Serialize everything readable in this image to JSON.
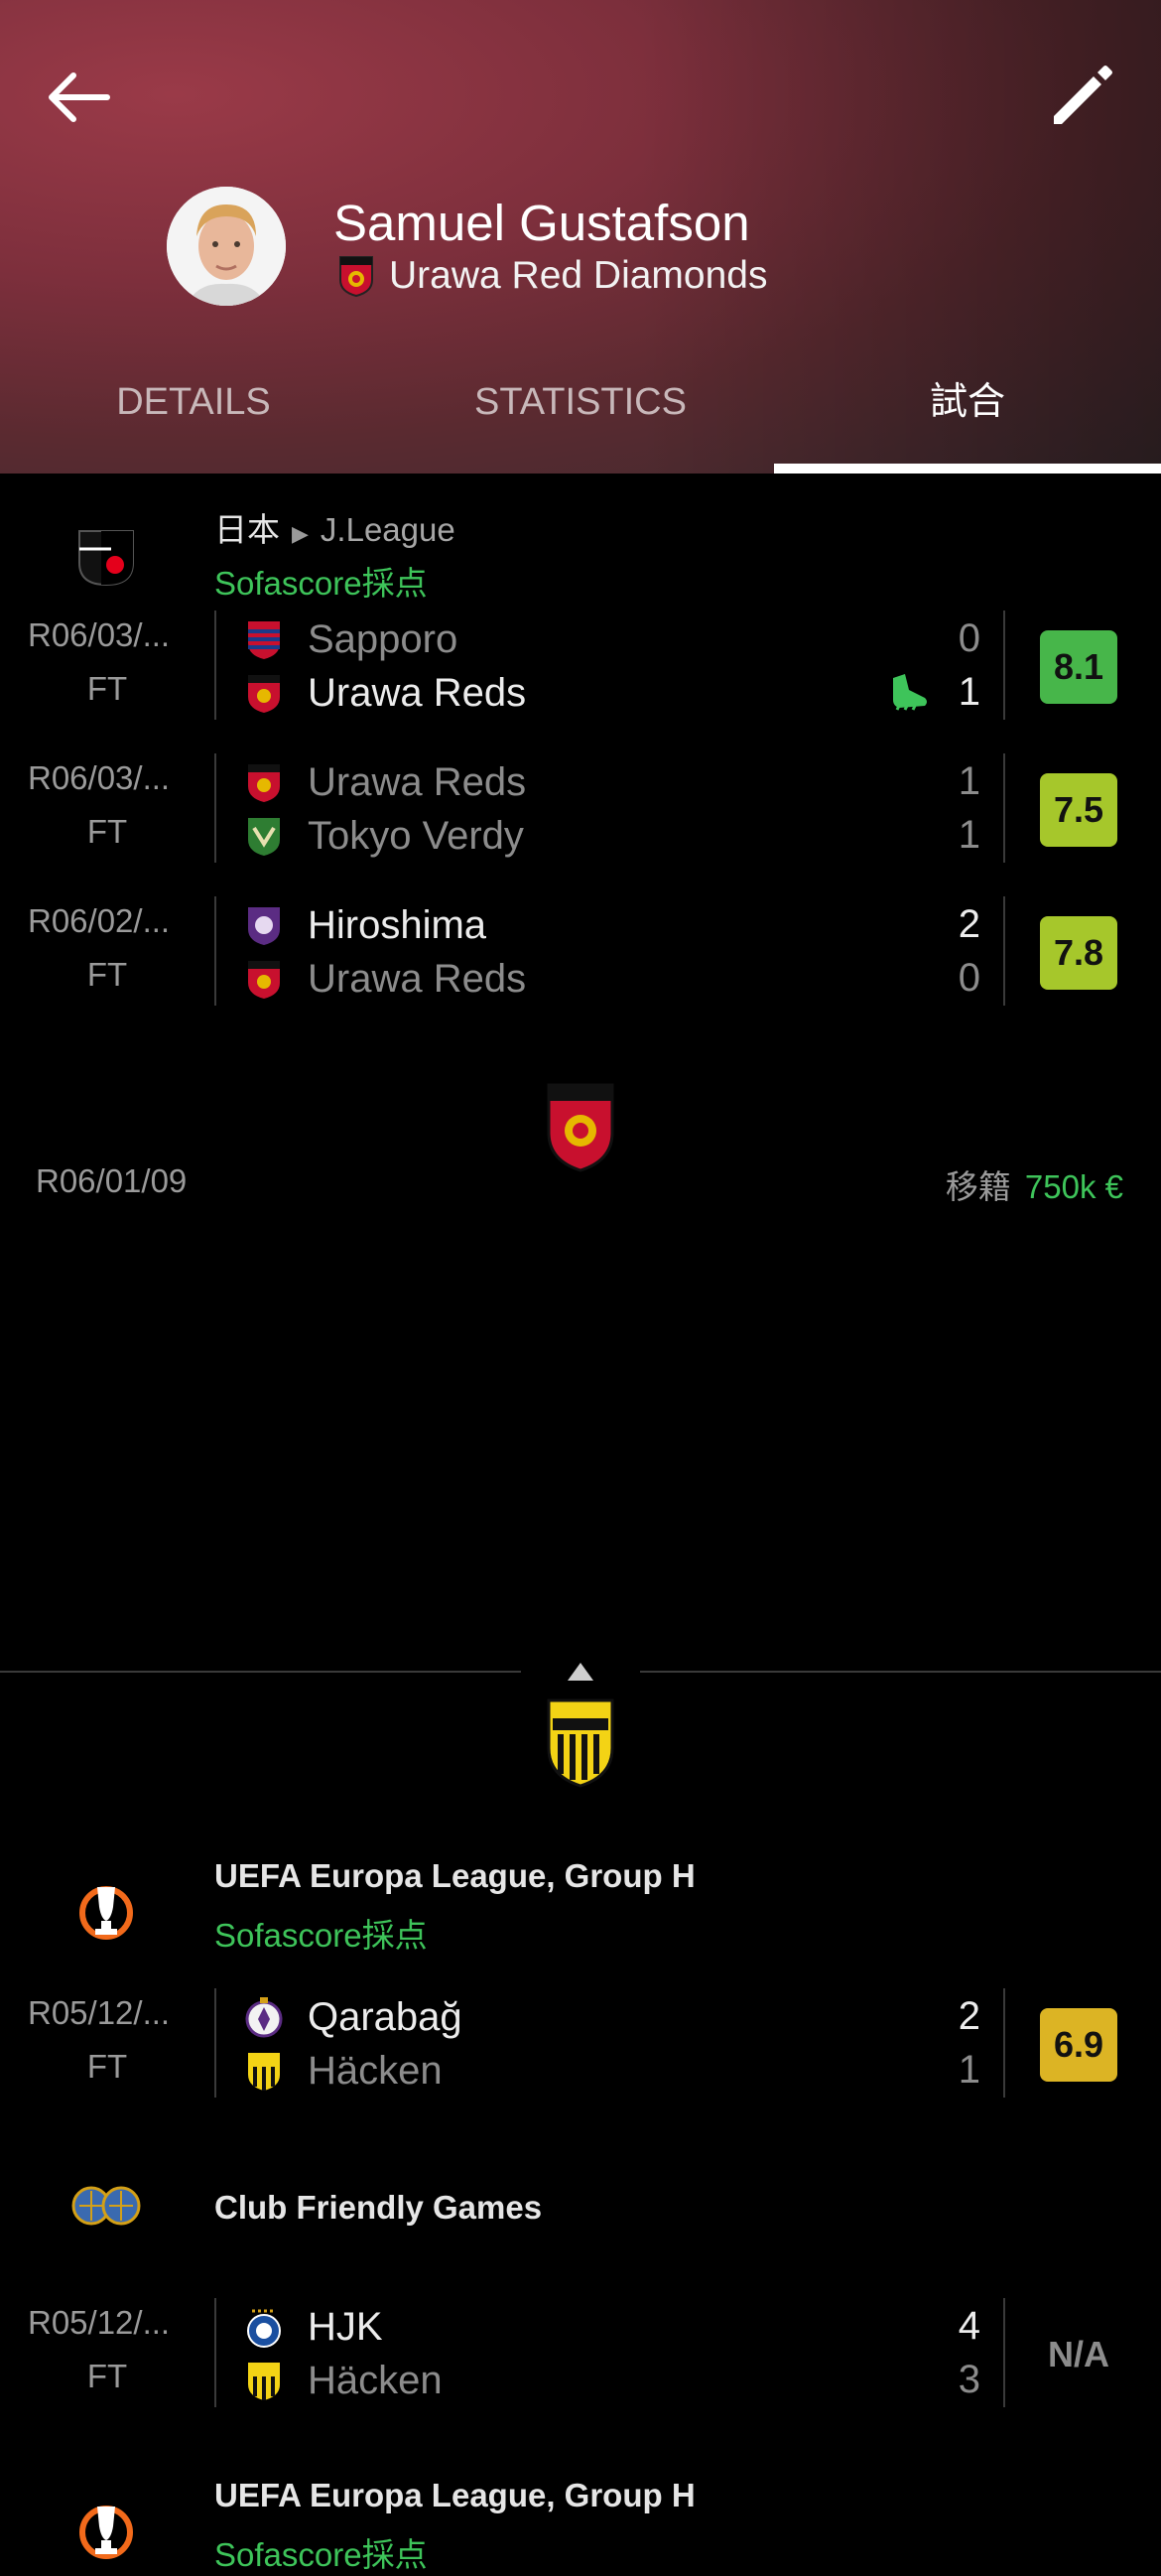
{
  "header": {
    "player_name": "Samuel Gustafson",
    "team_name": "Urawa Red Diamonds",
    "tabs": [
      "DETAILS",
      "STATISTICS",
      "試合"
    ],
    "active_tab": 2
  },
  "sections": [
    {
      "country": "日本",
      "competition": "J.League",
      "rating_label": "Sofascore採点",
      "matches": [
        {
          "date": "R06/03/...",
          "status": "FT",
          "home": "Sapporo",
          "away": "Urawa Reds",
          "home_score": "0",
          "away_score": "1",
          "winner": "away",
          "rating": "8.1",
          "rating_color": "#47b64a",
          "icon": "boot-icon"
        },
        {
          "date": "R06/03/...",
          "status": "FT",
          "home": "Urawa Reds",
          "away": "Tokyo Verdy",
          "home_score": "1",
          "away_score": "1",
          "winner": "none",
          "rating": "7.5",
          "rating_color": "#a6c72b"
        },
        {
          "date": "R06/02/...",
          "status": "FT",
          "home": "Hiroshima",
          "away": "Urawa Reds",
          "home_score": "2",
          "away_score": "0",
          "winner": "home",
          "rating": "7.8",
          "rating_color": "#a6c72b"
        }
      ]
    },
    {
      "competition": "UEFA Europa League, Group H",
      "rating_label": "Sofascore採点",
      "matches": [
        {
          "date": "R05/12/...",
          "status": "FT",
          "home": "Qarabağ",
          "away": "Häcken",
          "home_score": "2",
          "away_score": "1",
          "winner": "home",
          "rating": "6.9",
          "rating_color": "#dcb424"
        }
      ]
    },
    {
      "competition": "Club Friendly Games",
      "matches": [
        {
          "date": "R05/12/...",
          "status": "FT",
          "home": "HJK",
          "away": "Häcken",
          "home_score": "4",
          "away_score": "3",
          "winner": "home",
          "rating": "N/A",
          "rating_color": ""
        }
      ]
    },
    {
      "competition": "UEFA Europa League, Group H",
      "rating_label": "Sofascore採点"
    }
  ],
  "transfer": {
    "date": "R06/01/09",
    "label": "移籍",
    "fee": "750k €"
  },
  "colors": {
    "accent_green": "#3ec45a",
    "muted_text": "#9a9a9a"
  }
}
